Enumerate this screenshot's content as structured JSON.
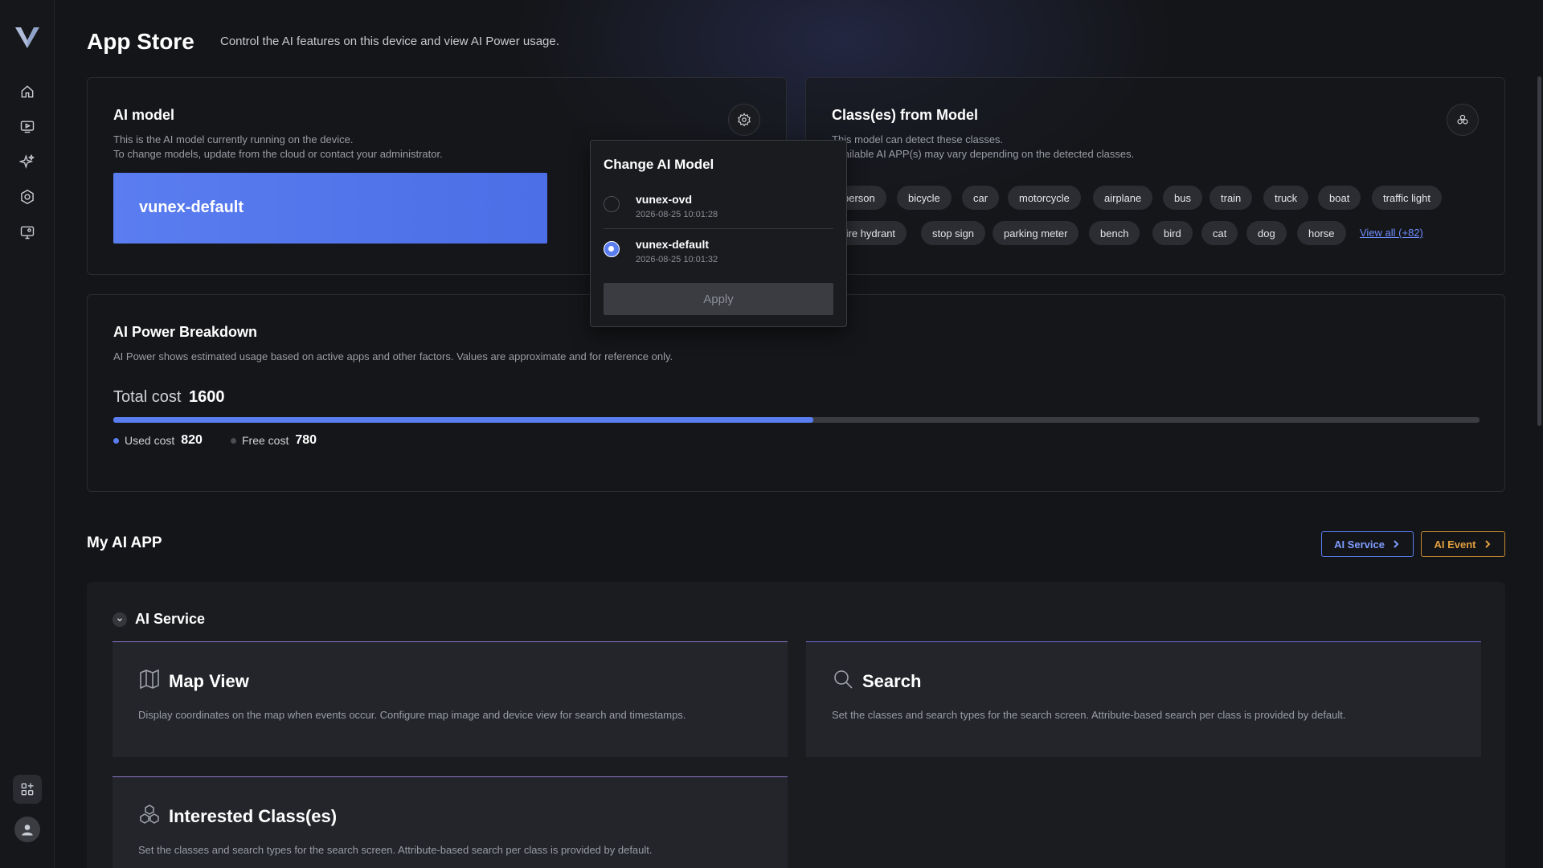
{
  "header": {
    "title": "App Store",
    "subtitle": "Control the AI features on this device and view AI Power usage."
  },
  "sidebar": {
    "items": [
      {
        "icon": "home-icon"
      },
      {
        "icon": "video-icon"
      },
      {
        "icon": "sparkle-ai-icon"
      },
      {
        "icon": "settings-icon"
      },
      {
        "icon": "monitor-settings-icon"
      }
    ]
  },
  "ai_model": {
    "title": "AI model",
    "desc1": "This is the AI model currently running on the device.",
    "desc2": "To change models, update from the cloud or contact your administrator.",
    "current": "vunex-default"
  },
  "change_popup": {
    "title": "Change AI Model",
    "options": [
      {
        "name": "vunex-ovd",
        "date": "2026-08-25 10:01:28",
        "selected": false
      },
      {
        "name": "vunex-default",
        "date": "2026-08-25 10:01:32",
        "selected": true
      }
    ],
    "apply": "Apply"
  },
  "classes": {
    "title": "Class(es) from Model",
    "desc1": "This model can detect these classes.",
    "desc2": "Available AI APP(s) may vary depending on the detected classes.",
    "row1": [
      "person",
      "bicycle",
      "car",
      "motorcycle",
      "airplane",
      "bus",
      "train",
      "truck",
      "boat",
      "traffic light"
    ],
    "row2": [
      "fire hydrant",
      "stop sign",
      "parking meter",
      "bench",
      "bird",
      "cat",
      "dog",
      "horse"
    ],
    "view_all": "View all (+82)"
  },
  "power": {
    "title": "AI Power Breakdown",
    "desc": "AI Power shows estimated usage based on active apps and other factors. Values are approximate and for reference only.",
    "total_label": "Total cost",
    "total": "1600",
    "used_label": "Used cost",
    "used": "820",
    "free_label": "Free cost",
    "free": "780",
    "used_fraction": 0.5125,
    "used_color": "#5a7df0",
    "free_color": "#4a4c52"
  },
  "my_app": {
    "title": "My AI APP",
    "btn_service": "AI Service",
    "btn_event": "AI Event",
    "service_color": "#5a7df0",
    "event_color": "#e0a040",
    "section": "AI Service",
    "cards": [
      {
        "title": "Map View",
        "icon": "map-icon",
        "desc": "Display coordinates on the map when events occur. Configure map image and device view for search and timestamps."
      },
      {
        "title": "Search",
        "icon": "search-icon",
        "desc": "Set the classes and search types for the search screen. Attribute-based search per class is provided by default."
      },
      {
        "title": "Interested Class(es)",
        "icon": "cubes-icon",
        "desc": "Set the classes and search types for the search screen. Attribute-based search per class is provided by default."
      }
    ]
  }
}
